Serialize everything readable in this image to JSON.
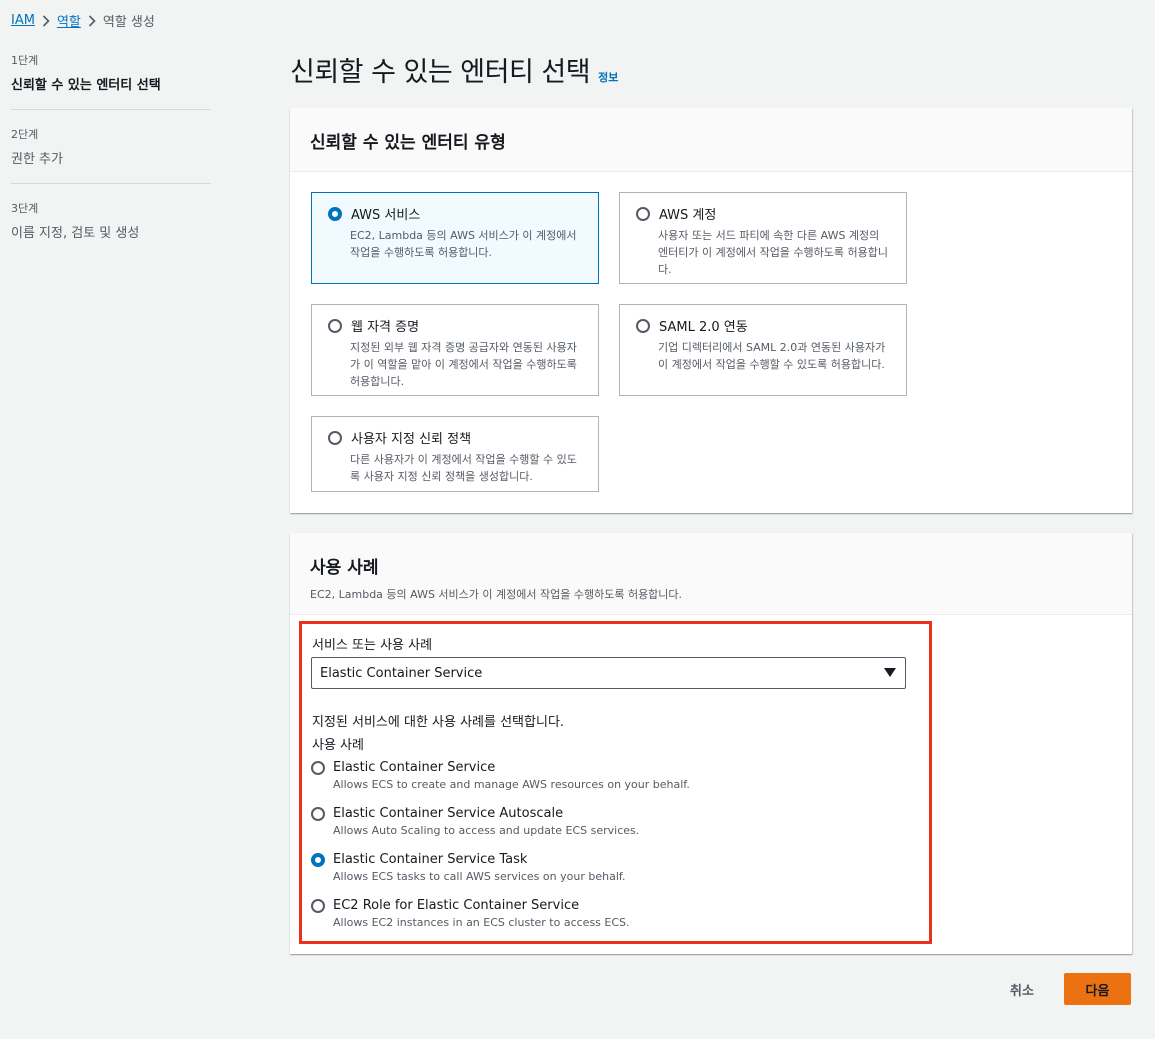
{
  "breadcrumb": {
    "items": [
      {
        "label": "IAM"
      },
      {
        "label": "역할"
      },
      {
        "label": "역할 생성"
      }
    ]
  },
  "steps": [
    {
      "number": "1단계",
      "title": "신뢰할 수 있는 엔터티 선택",
      "active": true
    },
    {
      "number": "2단계",
      "title": "권한 추가",
      "active": false
    },
    {
      "number": "3단계",
      "title": "이름 지정, 검토 및 생성",
      "active": false
    }
  ],
  "page": {
    "title": "신뢰할 수 있는 엔터티 선택",
    "info_link": "정보"
  },
  "entity_type": {
    "heading": "신뢰할 수 있는 엔터티 유형",
    "tiles": [
      {
        "title": "AWS 서비스",
        "desc": "EC2, Lambda 등의 AWS 서비스가 이 계정에서 작업을 수행하도록 허용합니다.",
        "selected": true
      },
      {
        "title": "AWS 계정",
        "desc": "사용자 또는 서드 파티에 속한 다른 AWS 계정의 엔터티가 이 계정에서 작업을 수행하도록 허용합니다.",
        "selected": false
      },
      {
        "title": "웹 자격 증명",
        "desc": "지정된 외부 웹 자격 증명 공급자와 연동된 사용자가 이 역할을 맡아 이 계정에서 작업을 수행하도록 허용합니다.",
        "selected": false
      },
      {
        "title": "SAML 2.0 연동",
        "desc": "기업 디렉터리에서 SAML 2.0과 연동된 사용자가 이 계정에서 작업을 수행할 수 있도록 허용합니다.",
        "selected": false
      },
      {
        "title": "사용자 지정 신뢰 정책",
        "desc": "다른 사용자가 이 계정에서 작업을 수행할 수 있도록 사용자 지정 신뢰 정책을 생성합니다.",
        "selected": false
      }
    ]
  },
  "use_case": {
    "heading": "사용 사례",
    "description": "EC2, Lambda 등의 AWS 서비스가 이 계정에서 작업을 수행하도록 허용합니다.",
    "select_label": "서비스 또는 사용 사례",
    "select_value": "Elastic Container Service",
    "hint": "지정된 서비스에 대한 사용 사례를 선택합니다.",
    "options_label": "사용 사례",
    "options": [
      {
        "title": "Elastic Container Service",
        "desc": "Allows ECS to create and manage AWS resources on your behalf.",
        "checked": false
      },
      {
        "title": "Elastic Container Service Autoscale",
        "desc": "Allows Auto Scaling to access and update ECS services.",
        "checked": false
      },
      {
        "title": "Elastic Container Service Task",
        "desc": "Allows ECS tasks to call AWS services on your behalf.",
        "checked": true
      },
      {
        "title": "EC2 Role for Elastic Container Service",
        "desc": "Allows EC2 instances in an ECS cluster to access ECS.",
        "checked": false
      }
    ]
  },
  "footer": {
    "cancel_label": "취소",
    "next_label": "다음"
  },
  "colors": {
    "accent": "#0073bb",
    "primary_button": "#ec7211",
    "highlight_border": "#e8321d"
  }
}
